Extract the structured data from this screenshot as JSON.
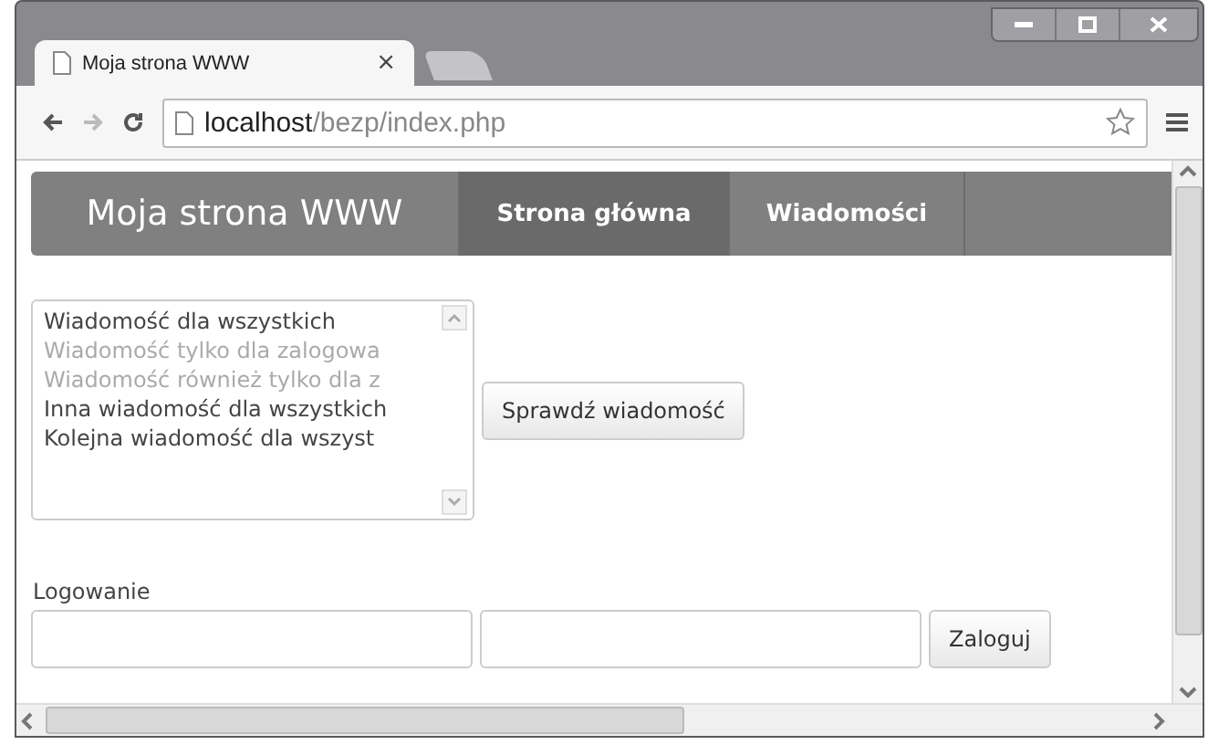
{
  "browser": {
    "tab_title": "Moja strona WWW",
    "tab_close": "×",
    "address_host": "localhost",
    "address_path": "/bezp/index.php"
  },
  "navbar": {
    "brand": "Moja strona WWW",
    "items": [
      {
        "label": "Strona główna",
        "selected": true
      },
      {
        "label": "Wiadomości",
        "selected": false
      }
    ]
  },
  "messages": {
    "items": [
      {
        "text": "Wiadomość dla wszystkich",
        "disabled": false
      },
      {
        "text": "Wiadomość tylko dla zalogowa",
        "disabled": true
      },
      {
        "text": "Wiadomość również tylko dla z",
        "disabled": true
      },
      {
        "text": "Inna wiadomość dla wszystkich",
        "disabled": false
      },
      {
        "text": "Kolejna wiadomość dla wszyst",
        "disabled": false
      }
    ],
    "button": "Sprawdź wiadomość"
  },
  "login": {
    "label": "Logowanie",
    "button": "Zaloguj"
  }
}
